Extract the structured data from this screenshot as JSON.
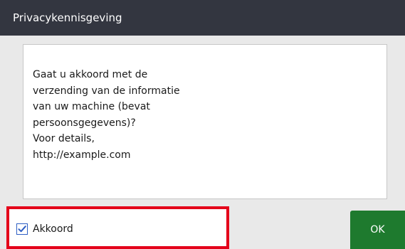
{
  "dialog": {
    "title": "Privacykennisgeving",
    "message": "Gaat u akkoord met de\nverzending van de informatie\nvan uw machine (bevat\npersoonsgegevens)?\nVoor details,\nhttp://example.com"
  },
  "agree": {
    "label": "Akkoord",
    "checked": true
  },
  "ok_button": {
    "label": "OK"
  },
  "colors": {
    "title_bar": "#333640",
    "ok_button": "#1e7a2e",
    "highlight_border": "#e4001a",
    "checkbox_accent": "#2f5fc4"
  }
}
